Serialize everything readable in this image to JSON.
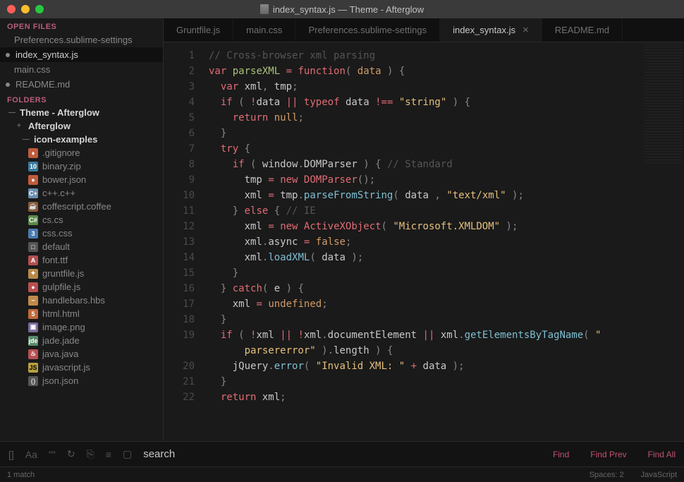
{
  "window": {
    "title": "index_syntax.js — Theme - Afterglow"
  },
  "sidebar": {
    "open_files_label": "OPEN FILES",
    "open_files": [
      {
        "name": "Preferences.sublime-settings",
        "active": false,
        "dirty": false
      },
      {
        "name": "index_syntax.js",
        "active": true,
        "dirty": true
      },
      {
        "name": "main.css",
        "active": false,
        "dirty": false
      },
      {
        "name": "README.md",
        "active": false,
        "dirty": true
      }
    ],
    "folders_label": "FOLDERS",
    "root": {
      "name": "Theme - Afterglow",
      "expanded": true
    },
    "sub1": {
      "name": "Afterglow",
      "expanded": false
    },
    "sub2": {
      "name": "icon-examples",
      "expanded": true
    },
    "files": [
      {
        "name": ".gitignore",
        "icon": "fi-git",
        "glyph": "♦"
      },
      {
        "name": "binary.zip",
        "icon": "fi-zip",
        "glyph": "10"
      },
      {
        "name": "bower.json",
        "icon": "fi-bower",
        "glyph": "●"
      },
      {
        "name": "c++.c++",
        "icon": "fi-cpp",
        "glyph": "C+"
      },
      {
        "name": "coffescript.coffee",
        "icon": "fi-coffee",
        "glyph": "☕"
      },
      {
        "name": "cs.cs",
        "icon": "fi-cs",
        "glyph": "C#"
      },
      {
        "name": "css.css",
        "icon": "fi-css",
        "glyph": "3"
      },
      {
        "name": "default",
        "icon": "fi-def",
        "glyph": "□"
      },
      {
        "name": "font.ttf",
        "icon": "fi-font",
        "glyph": "A"
      },
      {
        "name": "gruntfile.js",
        "icon": "fi-grunt",
        "glyph": "✦"
      },
      {
        "name": "gulpfile.js",
        "icon": "fi-gulp",
        "glyph": "●"
      },
      {
        "name": "handlebars.hbs",
        "icon": "fi-hbs",
        "glyph": "⎯"
      },
      {
        "name": "html.html",
        "icon": "fi-html",
        "glyph": "5"
      },
      {
        "name": "image.png",
        "icon": "fi-img",
        "glyph": "▣"
      },
      {
        "name": "jade.jade",
        "icon": "fi-jade",
        "glyph": "jde"
      },
      {
        "name": "java.java",
        "icon": "fi-java",
        "glyph": "♨"
      },
      {
        "name": "javascript.js",
        "icon": "fi-js",
        "glyph": "JS"
      },
      {
        "name": "json.json",
        "icon": "fi-json",
        "glyph": "{}"
      }
    ]
  },
  "tabs": [
    {
      "label": "Gruntfile.js",
      "active": false
    },
    {
      "label": "main.css",
      "active": false
    },
    {
      "label": "Preferences.sublime-settings",
      "active": false
    },
    {
      "label": "index_syntax.js",
      "active": true
    },
    {
      "label": "README.md",
      "active": false
    }
  ],
  "code_lines": [
    [
      {
        "c": "c-comment",
        "t": "// Cross-browser xml parsing"
      }
    ],
    [
      {
        "c": "c-keyword",
        "t": "var"
      },
      {
        "t": " "
      },
      {
        "c": "c-func",
        "t": "parseXML"
      },
      {
        "t": " "
      },
      {
        "c": "c-op",
        "t": "="
      },
      {
        "t": " "
      },
      {
        "c": "c-keyword",
        "t": "function"
      },
      {
        "c": "c-paren",
        "t": "("
      },
      {
        "t": " "
      },
      {
        "c": "c-const",
        "t": "data"
      },
      {
        "t": " "
      },
      {
        "c": "c-paren",
        "t": ")"
      },
      {
        "t": " "
      },
      {
        "c": "c-punct",
        "t": "{"
      }
    ],
    [
      {
        "t": "  "
      },
      {
        "c": "c-keyword",
        "t": "var"
      },
      {
        "t": " "
      },
      {
        "c": "c-var",
        "t": "xml"
      },
      {
        "c": "c-punct",
        "t": ","
      },
      {
        "t": " "
      },
      {
        "c": "c-var",
        "t": "tmp"
      },
      {
        "c": "c-punct",
        "t": ";"
      }
    ],
    [
      {
        "t": "  "
      },
      {
        "c": "c-keyword",
        "t": "if"
      },
      {
        "t": " "
      },
      {
        "c": "c-paren",
        "t": "("
      },
      {
        "t": " "
      },
      {
        "c": "c-op",
        "t": "!"
      },
      {
        "c": "c-var",
        "t": "data"
      },
      {
        "t": " "
      },
      {
        "c": "c-op",
        "t": "||"
      },
      {
        "t": " "
      },
      {
        "c": "c-keyword",
        "t": "typeof"
      },
      {
        "t": " "
      },
      {
        "c": "c-var",
        "t": "data"
      },
      {
        "t": " "
      },
      {
        "c": "c-op",
        "t": "!=="
      },
      {
        "t": " "
      },
      {
        "c": "c-string",
        "t": "\"string\""
      },
      {
        "t": " "
      },
      {
        "c": "c-paren",
        "t": ")"
      },
      {
        "t": " "
      },
      {
        "c": "c-punct",
        "t": "{"
      }
    ],
    [
      {
        "t": "    "
      },
      {
        "c": "c-keyword",
        "t": "return"
      },
      {
        "t": " "
      },
      {
        "c": "c-const",
        "t": "null"
      },
      {
        "c": "c-punct",
        "t": ";"
      }
    ],
    [
      {
        "t": "  "
      },
      {
        "c": "c-punct",
        "t": "}"
      }
    ],
    [
      {
        "t": "  "
      },
      {
        "c": "c-keyword",
        "t": "try"
      },
      {
        "t": " "
      },
      {
        "c": "c-punct",
        "t": "{"
      }
    ],
    [
      {
        "t": "    "
      },
      {
        "c": "c-keyword",
        "t": "if"
      },
      {
        "t": " "
      },
      {
        "c": "c-paren",
        "t": "("
      },
      {
        "t": " "
      },
      {
        "c": "c-var",
        "t": "window"
      },
      {
        "c": "c-punct",
        "t": "."
      },
      {
        "c": "c-var",
        "t": "DOMParser"
      },
      {
        "t": " "
      },
      {
        "c": "c-paren",
        "t": ")"
      },
      {
        "t": " "
      },
      {
        "c": "c-punct",
        "t": "{"
      },
      {
        "t": " "
      },
      {
        "c": "c-comment",
        "t": "// Standard"
      }
    ],
    [
      {
        "t": "      "
      },
      {
        "c": "c-var",
        "t": "tmp"
      },
      {
        "t": " "
      },
      {
        "c": "c-op",
        "t": "="
      },
      {
        "t": " "
      },
      {
        "c": "c-keyword",
        "t": "new"
      },
      {
        "t": " "
      },
      {
        "c": "c-type",
        "t": "DOMParser"
      },
      {
        "c": "c-paren",
        "t": "()"
      },
      {
        "c": "c-punct",
        "t": ";"
      }
    ],
    [
      {
        "t": "      "
      },
      {
        "c": "c-var",
        "t": "xml"
      },
      {
        "t": " "
      },
      {
        "c": "c-op",
        "t": "="
      },
      {
        "t": " "
      },
      {
        "c": "c-var",
        "t": "tmp"
      },
      {
        "c": "c-punct",
        "t": "."
      },
      {
        "c": "c-prop",
        "t": "parseFromString"
      },
      {
        "c": "c-paren",
        "t": "("
      },
      {
        "t": " "
      },
      {
        "c": "c-var",
        "t": "data"
      },
      {
        "t": " "
      },
      {
        "c": "c-punct",
        "t": ","
      },
      {
        "t": " "
      },
      {
        "c": "c-string",
        "t": "\"text/xml\""
      },
      {
        "t": " "
      },
      {
        "c": "c-paren",
        "t": ")"
      },
      {
        "c": "c-punct",
        "t": ";"
      }
    ],
    [
      {
        "t": "    "
      },
      {
        "c": "c-punct",
        "t": "}"
      },
      {
        "t": " "
      },
      {
        "c": "c-keyword",
        "t": "else"
      },
      {
        "t": " "
      },
      {
        "c": "c-punct",
        "t": "{"
      },
      {
        "t": " "
      },
      {
        "c": "c-comment",
        "t": "// IE"
      }
    ],
    [
      {
        "t": "      "
      },
      {
        "c": "c-var",
        "t": "xml"
      },
      {
        "t": " "
      },
      {
        "c": "c-op",
        "t": "="
      },
      {
        "t": " "
      },
      {
        "c": "c-keyword",
        "t": "new"
      },
      {
        "t": " "
      },
      {
        "c": "c-type",
        "t": "ActiveXObject"
      },
      {
        "c": "c-paren",
        "t": "("
      },
      {
        "t": " "
      },
      {
        "c": "c-string",
        "t": "\"Microsoft.XMLDOM\""
      },
      {
        "t": " "
      },
      {
        "c": "c-paren",
        "t": ")"
      },
      {
        "c": "c-punct",
        "t": ";"
      }
    ],
    [
      {
        "t": "      "
      },
      {
        "c": "c-var",
        "t": "xml"
      },
      {
        "c": "c-punct",
        "t": "."
      },
      {
        "c": "c-var",
        "t": "async"
      },
      {
        "t": " "
      },
      {
        "c": "c-op",
        "t": "="
      },
      {
        "t": " "
      },
      {
        "c": "c-const",
        "t": "false"
      },
      {
        "c": "c-punct",
        "t": ";"
      }
    ],
    [
      {
        "t": "      "
      },
      {
        "c": "c-var",
        "t": "xml"
      },
      {
        "c": "c-punct",
        "t": "."
      },
      {
        "c": "c-prop",
        "t": "loadXML"
      },
      {
        "c": "c-paren",
        "t": "("
      },
      {
        "t": " "
      },
      {
        "c": "c-var",
        "t": "data"
      },
      {
        "t": " "
      },
      {
        "c": "c-paren",
        "t": ")"
      },
      {
        "c": "c-punct",
        "t": ";"
      }
    ],
    [
      {
        "t": "    "
      },
      {
        "c": "c-punct",
        "t": "}"
      }
    ],
    [
      {
        "t": "  "
      },
      {
        "c": "c-punct",
        "t": "}"
      },
      {
        "t": " "
      },
      {
        "c": "c-keyword",
        "t": "catch"
      },
      {
        "c": "c-paren",
        "t": "("
      },
      {
        "t": " "
      },
      {
        "c": "c-var",
        "t": "e"
      },
      {
        "t": " "
      },
      {
        "c": "c-paren",
        "t": ")"
      },
      {
        "t": " "
      },
      {
        "c": "c-punct",
        "t": "{"
      }
    ],
    [
      {
        "t": "    "
      },
      {
        "c": "c-var",
        "t": "xml"
      },
      {
        "t": " "
      },
      {
        "c": "c-op",
        "t": "="
      },
      {
        "t": " "
      },
      {
        "c": "c-const",
        "t": "undefined"
      },
      {
        "c": "c-punct",
        "t": ";"
      }
    ],
    [
      {
        "t": "  "
      },
      {
        "c": "c-punct",
        "t": "}"
      }
    ],
    [
      {
        "t": "  "
      },
      {
        "c": "c-keyword",
        "t": "if"
      },
      {
        "t": " "
      },
      {
        "c": "c-paren",
        "t": "("
      },
      {
        "t": " "
      },
      {
        "c": "c-op",
        "t": "!"
      },
      {
        "c": "c-var",
        "t": "xml"
      },
      {
        "t": " "
      },
      {
        "c": "c-op",
        "t": "||"
      },
      {
        "t": " "
      },
      {
        "c": "c-op",
        "t": "!"
      },
      {
        "c": "c-var",
        "t": "xml"
      },
      {
        "c": "c-punct",
        "t": "."
      },
      {
        "c": "c-var",
        "t": "documentElement"
      },
      {
        "t": " "
      },
      {
        "c": "c-op",
        "t": "||"
      },
      {
        "t": " "
      },
      {
        "c": "c-var",
        "t": "xml"
      },
      {
        "c": "c-punct",
        "t": "."
      },
      {
        "c": "c-prop",
        "t": "getElementsByTagName"
      },
      {
        "c": "c-paren",
        "t": "("
      },
      {
        "t": " "
      },
      {
        "c": "c-string",
        "t": "\""
      }
    ],
    [
      {
        "t": "      "
      },
      {
        "c": "c-string",
        "t": "parsererror\""
      },
      {
        "t": " "
      },
      {
        "c": "c-paren",
        "t": ")"
      },
      {
        "c": "c-punct",
        "t": "."
      },
      {
        "c": "c-var",
        "t": "length"
      },
      {
        "t": " "
      },
      {
        "c": "c-paren",
        "t": ")"
      },
      {
        "t": " "
      },
      {
        "c": "c-punct",
        "t": "{"
      }
    ],
    [
      {
        "t": "    "
      },
      {
        "c": "c-var",
        "t": "jQuery"
      },
      {
        "c": "c-punct",
        "t": "."
      },
      {
        "c": "c-prop",
        "t": "error"
      },
      {
        "c": "c-paren",
        "t": "("
      },
      {
        "t": " "
      },
      {
        "c": "c-string",
        "t": "\"Invalid XML: \""
      },
      {
        "t": " "
      },
      {
        "c": "c-op",
        "t": "+"
      },
      {
        "t": " "
      },
      {
        "c": "c-var",
        "t": "data"
      },
      {
        "t": " "
      },
      {
        "c": "c-paren",
        "t": ")"
      },
      {
        "c": "c-punct",
        "t": ";"
      }
    ],
    [
      {
        "t": "  "
      },
      {
        "c": "c-punct",
        "t": "}"
      }
    ],
    [
      {
        "t": "  "
      },
      {
        "c": "c-keyword",
        "t": "return"
      },
      {
        "t": " "
      },
      {
        "c": "c-var",
        "t": "xml"
      },
      {
        "c": "c-punct",
        "t": ";"
      }
    ]
  ],
  "line_numbers": [
    "1",
    "2",
    "3",
    "4",
    "5",
    "6",
    "7",
    "8",
    "9",
    "10",
    "11",
    "12",
    "13",
    "14",
    "15",
    "16",
    "17",
    "18",
    "19",
    "",
    "20",
    "21",
    "22"
  ],
  "search": {
    "placeholder": "search",
    "value": "search",
    "find": "Find",
    "find_prev": "Find Prev",
    "find_all": "Find All"
  },
  "status": {
    "left": "1 match",
    "spaces": "Spaces: 2",
    "syntax": "JavaScript"
  }
}
